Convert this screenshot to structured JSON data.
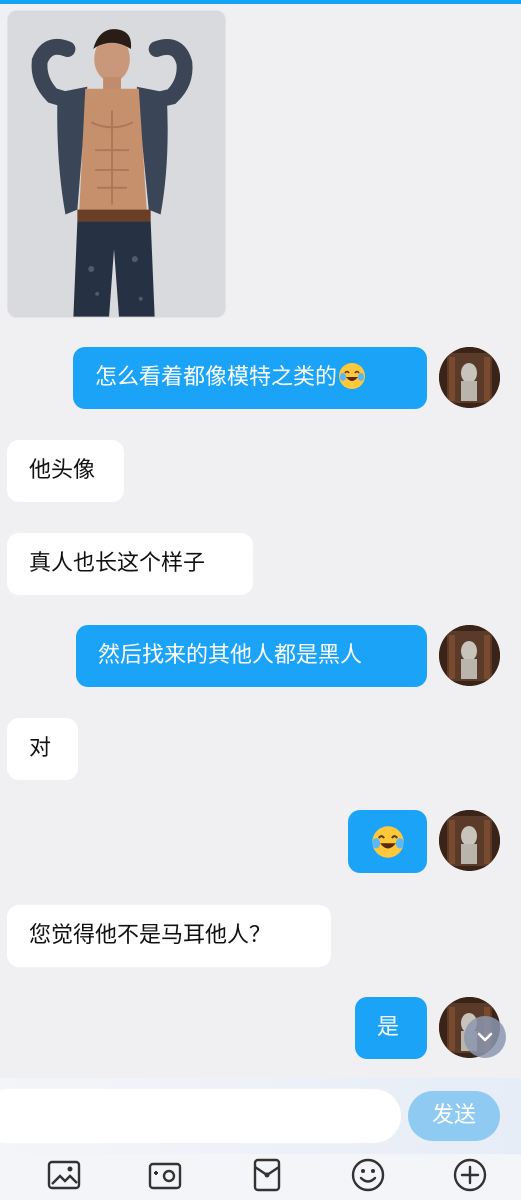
{
  "messages": [
    {
      "type": "image",
      "side": "in",
      "content": "shirtless male model photo"
    },
    {
      "type": "text",
      "side": "out",
      "text": "怎么看着都像模特之类的",
      "emoji": "tears-of-joy"
    },
    {
      "type": "text",
      "side": "in",
      "text": "他头像"
    },
    {
      "type": "text",
      "side": "in",
      "text": "真人也长这个样子"
    },
    {
      "type": "text",
      "side": "out",
      "text": "然后找来的其他人都是黑人"
    },
    {
      "type": "text",
      "side": "in",
      "text": "对"
    },
    {
      "type": "emoji",
      "side": "out",
      "emoji": "tears-of-joy"
    },
    {
      "type": "text",
      "side": "in",
      "text": "您觉得他不是马耳他人？"
    },
    {
      "type": "text",
      "side": "out",
      "text": "是"
    }
  ],
  "composer": {
    "placeholder": "",
    "send_label": "发送"
  },
  "toolbar": {
    "icons": [
      "image-icon",
      "camera-icon",
      "red-packet-icon",
      "emoji-icon",
      "plus-icon"
    ]
  },
  "colors": {
    "accent": "#12a3f5",
    "outgoing_bubble": "#1aa3f7",
    "incoming_bubble": "#ffffff",
    "background": "#f0f0f3",
    "send_button": "#8fcaf2"
  }
}
